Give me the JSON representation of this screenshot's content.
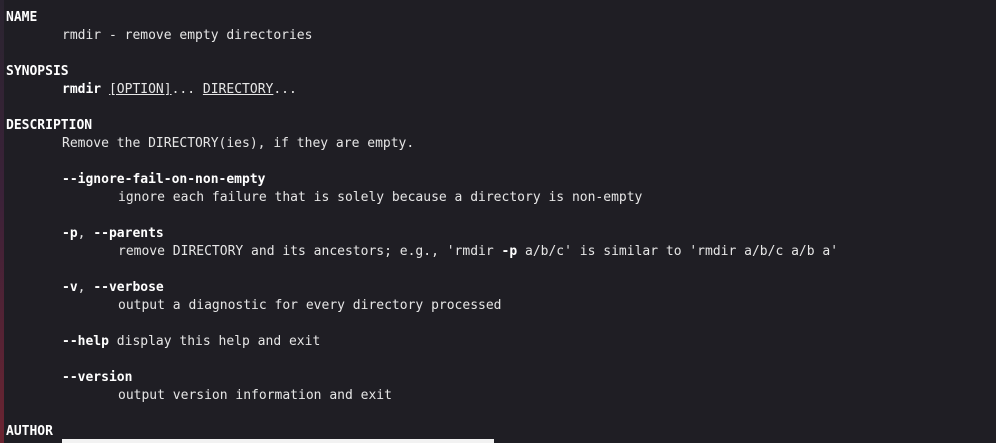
{
  "name": {
    "heading": "NAME",
    "text": "rmdir - remove empty directories"
  },
  "synopsis": {
    "heading": "SYNOPSIS",
    "command": "rmdir",
    "space": " ",
    "option": "[OPTION]",
    "ellipsis1": "... ",
    "directory": "DIRECTORY",
    "ellipsis2": "..."
  },
  "description": {
    "heading": "DESCRIPTION",
    "text": "Remove the DIRECTORY(ies), if they are empty."
  },
  "options": {
    "ignore": {
      "flag": "--ignore-fail-on-non-empty",
      "desc": "ignore each failure that is solely because a directory is non-empty"
    },
    "parents": {
      "flag_short": "-p",
      "sep": ", ",
      "flag_long": "--parents",
      "desc_before": "remove DIRECTORY and its ancestors; e.g., 'rmdir ",
      "desc_bold": "-p",
      "desc_after": " a/b/c' is similar to 'rmdir a/b/c a/b a'"
    },
    "verbose": {
      "flag_short": "-v",
      "sep": ", ",
      "flag_long": "--verbose",
      "desc": "output a diagnostic for every directory processed"
    },
    "help": {
      "flag": "--help",
      "desc": " display this help and exit"
    },
    "version": {
      "flag": "--version",
      "desc": "output version information and exit"
    }
  },
  "author": {
    "heading": "AUTHOR"
  }
}
